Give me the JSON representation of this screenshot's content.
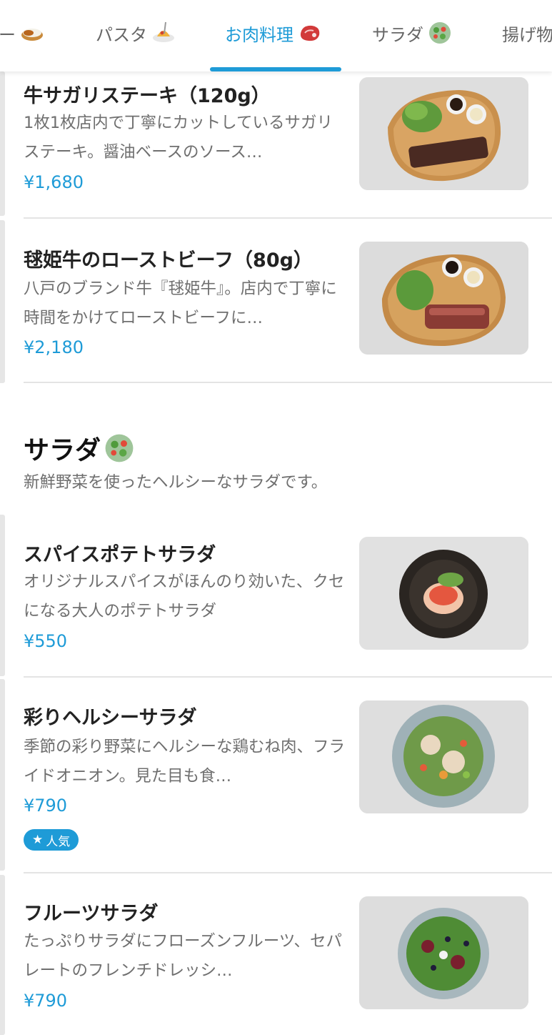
{
  "tabs": [
    {
      "label": "ー",
      "icon": "curry-icon"
    },
    {
      "label": "パスタ",
      "icon": "spaghetti-icon"
    },
    {
      "label": "お肉料理",
      "icon": "meat-icon",
      "active": true
    },
    {
      "label": "サラダ",
      "icon": "salad-icon"
    },
    {
      "label": "揚げ物",
      "icon": ""
    }
  ],
  "colors": {
    "accent": "#1e9bd7",
    "text": "#222222",
    "muted": "#6f6f6f"
  },
  "items": [
    {
      "name": "牛サガリステーキ（120g）",
      "desc": "1枚1枚店内で丁寧にカットしているサガリステーキ。醤油ベースのソース…",
      "price": "¥1,680",
      "image": "steak-plate-image"
    },
    {
      "name": "毬姫牛のローストビーフ（80g）",
      "desc": "八戸のブランド牛『毬姫牛』。店内で丁寧に時間をかけてローストビーフに…",
      "price": "¥2,180",
      "image": "roast-beef-plate-image"
    }
  ],
  "salad_section": {
    "title": "サラダ",
    "icon": "salad-icon",
    "desc": "新鮮野菜を使ったヘルシーなサラダです。"
  },
  "salad_items": [
    {
      "name": "スパイスポテトサラダ",
      "desc": "オリジナルスパイスがほんのり効いた、クセになる大人のポテトサラダ",
      "price": "¥550",
      "image": "potato-salad-image"
    },
    {
      "name": "彩りヘルシーサラダ",
      "desc": "季節の彩り野菜にヘルシーな鶏むね肉、フライドオニオン。見た目も食…",
      "price": "¥790",
      "badge": "人気",
      "image": "healthy-salad-image"
    },
    {
      "name": "フルーツサラダ",
      "desc": "たっぷりサラダにフローズンフルーツ、セパレートのフレンチドレッシ…",
      "price": "¥790",
      "image": "fruit-salad-image"
    }
  ]
}
